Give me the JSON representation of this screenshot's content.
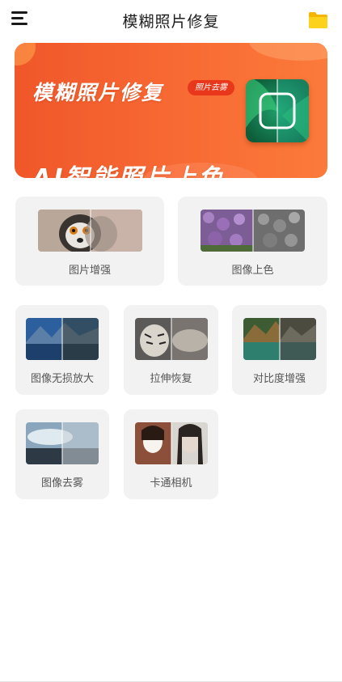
{
  "header": {
    "title": "模糊照片修复",
    "menu_icon": "menu-icon",
    "folder_icon": "folder-icon",
    "folder_color": "#f7c515"
  },
  "banner": {
    "title": "模糊照片修复",
    "badge": "照片去雾",
    "subtitle": "AI智能照片上色",
    "background": "#f86b34",
    "badge_color": "#e8371a"
  },
  "tools_row1": [
    {
      "label": "图片增强"
    },
    {
      "label": "图像上色"
    }
  ],
  "tools_row2": [
    {
      "label": "图像无损放大"
    },
    {
      "label": "拉伸恢复"
    },
    {
      "label": "对比度增强"
    }
  ],
  "tools_row3": [
    {
      "label": "图像去雾"
    },
    {
      "label": "卡通相机"
    }
  ]
}
